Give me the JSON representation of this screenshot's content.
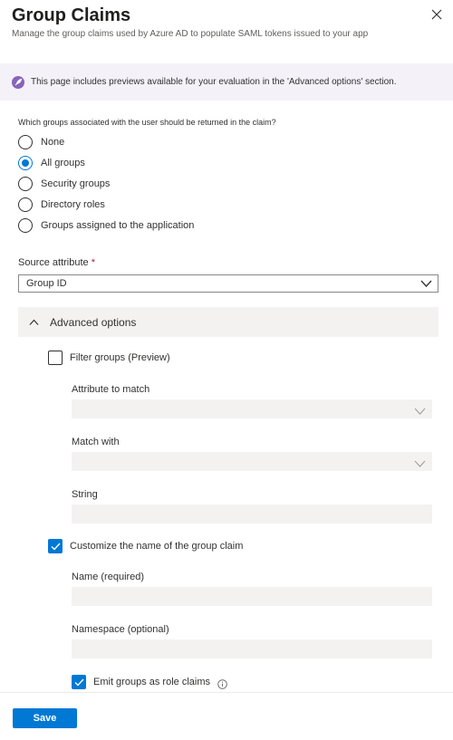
{
  "header": {
    "title": "Group Claims",
    "subtitle": "Manage the group claims used by Azure AD to populate SAML tokens issued to your app",
    "close_icon": "close-icon"
  },
  "banner": {
    "icon": "preview-rocket-icon",
    "text": "This page includes previews available for your evaluation in the 'Advanced options' section."
  },
  "groups": {
    "question": "Which groups associated with the user should be returned in the claim?",
    "options": [
      {
        "label": "None",
        "selected": false
      },
      {
        "label": "All groups",
        "selected": true
      },
      {
        "label": "Security groups",
        "selected": false
      },
      {
        "label": "Directory roles",
        "selected": false
      },
      {
        "label": "Groups assigned to the application",
        "selected": false
      }
    ]
  },
  "source_attribute": {
    "label": "Source attribute",
    "required_mark": "*",
    "value": "Group ID"
  },
  "advanced": {
    "header": "Advanced options",
    "filter_groups": {
      "label": "Filter groups (Preview)",
      "checked": false
    },
    "attribute_to_match": {
      "label": "Attribute to match",
      "value": ""
    },
    "match_with": {
      "label": "Match with",
      "value": ""
    },
    "string": {
      "label": "String",
      "value": ""
    },
    "customize_name": {
      "label": "Customize the name of the group claim",
      "checked": true
    },
    "name": {
      "label": "Name (required)",
      "value": ""
    },
    "namespace": {
      "label": "Namespace (optional)",
      "value": ""
    },
    "emit_roles": {
      "label": "Emit groups as role claims",
      "checked": true
    }
  },
  "footer": {
    "save_label": "Save"
  },
  "colors": {
    "accent": "#0078d4",
    "banner_bg": "#f4f1f9",
    "banner_icon": "#8764b8",
    "required": "#a4262c"
  }
}
